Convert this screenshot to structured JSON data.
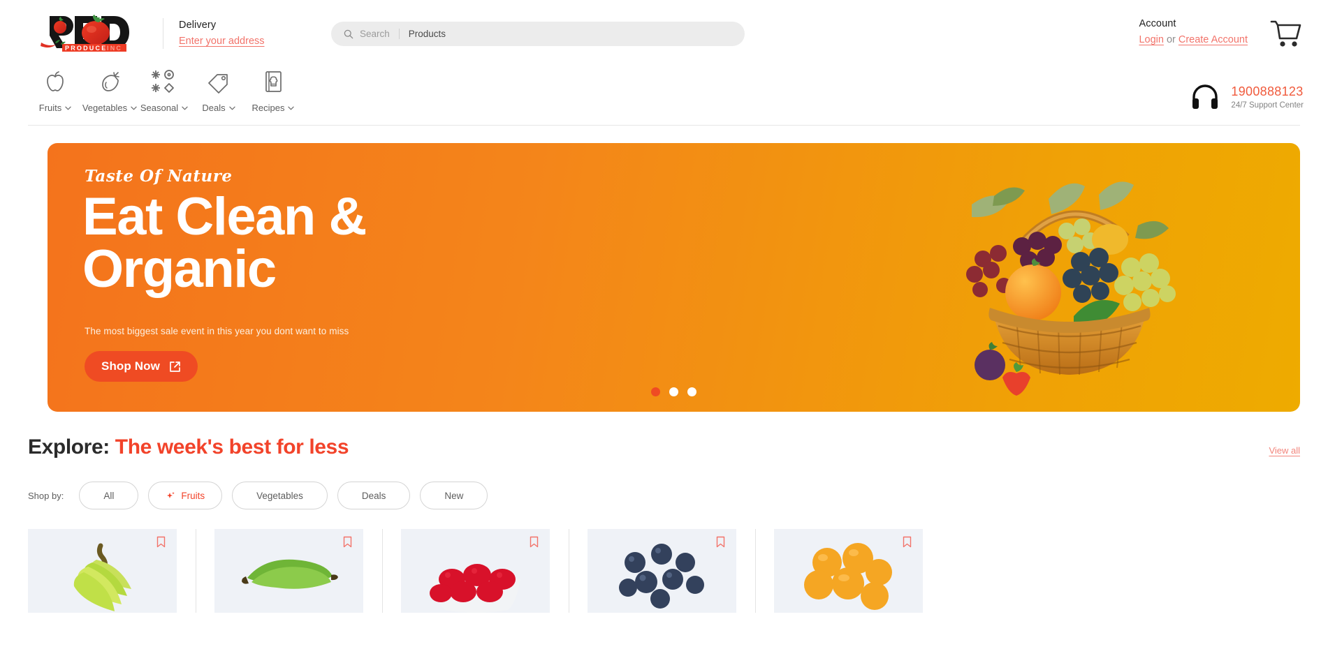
{
  "brand": {
    "name": "RED",
    "tagline": "PRODUCE INC",
    "accent_red": "#ef4b23",
    "accent_orange": "#f4731c",
    "link_coral": "#f2736a"
  },
  "header": {
    "delivery": {
      "label": "Delivery",
      "link": "Enter your address"
    },
    "search": {
      "placeholder": "Search",
      "category": "Products",
      "icon": "search-icon"
    },
    "account": {
      "label": "Account",
      "login": "Login",
      "or": "or",
      "create": "Create Account"
    },
    "cart": {
      "icon": "shopping-cart-icon"
    },
    "support": {
      "icon": "headphones-icon",
      "phone": "1900888123",
      "subtitle": "24/7 Support Center"
    }
  },
  "nav": {
    "items": [
      {
        "label": "Fruits",
        "icon": "apple-icon"
      },
      {
        "label": "Vegetables",
        "icon": "eggplant-icon"
      },
      {
        "label": "Seasonal",
        "icon": "seasonal-icon"
      },
      {
        "label": "Deals",
        "icon": "price-tag-icon"
      },
      {
        "label": "Recipes",
        "icon": "recipe-book-icon"
      }
    ],
    "chevron": "chevron-down-icon"
  },
  "hero": {
    "eyebrow": "Taste Of Nature",
    "title_line1": "Eat Clean &",
    "title_line2": "Organic",
    "subtitle": "The most biggest sale event in this year you dont want to miss",
    "cta_label": "Shop Now",
    "cta_icon": "external-link-icon",
    "art": "fruit-basket-illustration",
    "gradient_from": "#f4731c",
    "gradient_to": "#eeab00",
    "slides": 3,
    "active_slide": 1
  },
  "explore": {
    "label": "Explore:",
    "headline": "The week's best for less",
    "view_all": "View all"
  },
  "shop_by": {
    "label": "Shop by:",
    "chips": [
      {
        "label": "All",
        "active": false
      },
      {
        "label": "Fruits",
        "active": true,
        "icon": "sparkle-icon"
      },
      {
        "label": "Vegetables",
        "active": false
      },
      {
        "label": "Deals",
        "active": false
      },
      {
        "label": "New",
        "active": false
      }
    ]
  },
  "products": [
    {
      "name": "bananas",
      "art": "banana-bunch"
    },
    {
      "name": "green-bananas",
      "art": "green-banana"
    },
    {
      "name": "raspberries",
      "art": "raspberry-punnet"
    },
    {
      "name": "blueberries",
      "art": "blueberries"
    },
    {
      "name": "apricots",
      "art": "apricots"
    }
  ]
}
